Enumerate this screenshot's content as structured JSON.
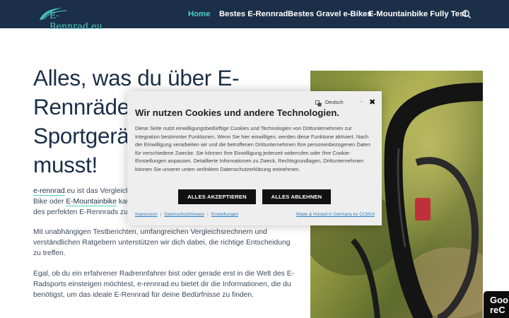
{
  "header": {
    "logo_text": "E-Rennrad.eu",
    "nav": [
      {
        "label": "Home",
        "active": true
      },
      {
        "label": "Bestes E-Rennrad",
        "active": false
      },
      {
        "label": "Bestes Gravel e-Bikes",
        "active": false
      },
      {
        "label": "E-Mountainbike Fully Test",
        "active": false
      }
    ],
    "search_icon": "search-icon"
  },
  "hero": {
    "title_lines": [
      "Alles, was du über E-",
      "Rennräde",
      "Sportgerä",
      "musst!"
    ],
    "para1": {
      "link1": "e-rennrad",
      "text1": ".eu ist das Vergleich",
      "text2": "Bike oder ",
      "link2": "E-Mountainbike",
      "text3": " kau",
      "text4": "des perfekten E-Rennrads zu"
    },
    "para2_lines": [
      "Mit unabhängigen Testberichten, umfangreichen Vergleichsrechnern und",
      "verständlichen Ratgebern unterstützen wir dich dabei, die richtige Entscheidung",
      "zu treffen."
    ],
    "para3_lines": [
      "Egal, ob du ein erfahrener Radrennfahrer bist oder gerade erst in die Welt des E-",
      "Radsports einsteigen möchtest, e-rennrad.eu bietet dir die Informationen, die du",
      "benötigst, um das ideale E-Rennrad für deine Bedürfnisse zu finden."
    ]
  },
  "cookie": {
    "language": "Deutsch",
    "title": "Wir nutzen Cookies und andere Technologien.",
    "text": "Diese Seite nutzt einwilligungsbedürftige Cookies und Technologien von Drittunternehmen zur Integration bestimmter Funktionen. Wenn Sie hier einwilligen, werden diese Funktione aktiviert. Nach der Einwilligung verarbeiten wir und die betroffenen Drittunternehmen Ihre personenbezogenen Daten für verschiedene Zwecke. Sie können Ihre Einwilligung jederzeit widerrufen oder Ihre Cookie-Einstellungen anpassen. Detaillierte Informationen zu Zweck, Rechtsgrundlagen, Drittunternehmen können Sie unserer unten verlinkten Datenschutzerklärung entnehmen.",
    "accept_label": "ALLES AKZEPTIEREN",
    "reject_label": "ALLES ABLEHNEN",
    "links": [
      "Impressum",
      "Datenschutzhinweis",
      "Einstellungen"
    ],
    "hosted": "Made & Hosted in Germany by CCM19"
  },
  "badge": {
    "text": "Goo\nreC"
  },
  "colors": {
    "header_bg": "#1b2f48",
    "accent": "#4ecdc4",
    "button_bg": "#111111"
  }
}
